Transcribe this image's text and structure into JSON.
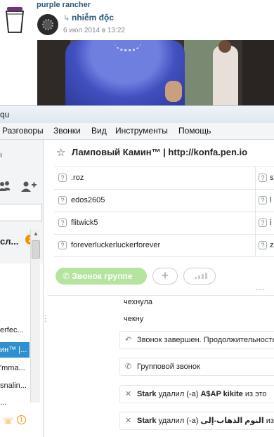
{
  "vk": {
    "author": "purple rancher",
    "repost_arrow": "↳",
    "repost_name": "nhiễm độc",
    "repost_date": "6 июл 2014 в 13:22"
  },
  "skype": {
    "title_fragment": "qu",
    "menu": [
      "Разговоры",
      "Звонки",
      "Вид",
      "Инструменты",
      "Помощь"
    ],
    "left": {
      "fragment_top": "ı",
      "recent_label": "сл...",
      "recent_badge": "2",
      "list_rows": [
        "erfec...",
        "ин™ |...",
        "'mma...",
        "snalin...",
        "..."
      ],
      "bottom_badge": "1"
    },
    "conversation": {
      "title": "Ламповый Камин™ | http://konfa.pen.io",
      "participants": [
        {
          "name": ".roz",
          "col2_frag": "s"
        },
        {
          "name": "edos2605",
          "col2_frag": "l"
        },
        {
          "name": "flitwick5",
          "col2_frag": "i"
        },
        {
          "name": "foreverluckerluckerforever",
          "col2_frag": "z"
        }
      ],
      "call_group_label": "Звонок группе",
      "add_label": "+",
      "more": "...",
      "messages": [
        {
          "text": "чехнула"
        },
        {
          "text": "чекну"
        }
      ],
      "events": [
        {
          "icon": "↶",
          "text": "Звонок завершен. Продолжительность"
        },
        {
          "icon": "✆",
          "text": "Групповой звонок"
        },
        {
          "icon": "✕",
          "bold": "Stark",
          "text": " удалил (-а) ",
          "target": "A$AP kikite",
          "tail": " из это"
        },
        {
          "icon": "✕",
          "bold": "Stark",
          "text": " удалил (-а) ",
          "target": "النوم الذهاب-إلى",
          "tail": " из этой"
        }
      ]
    }
  },
  "colors": {
    "link": "#2b587a",
    "accent_green": "#b7e3a0",
    "selected_row": "#2f8fd0",
    "badge_orange": "#f39200"
  }
}
